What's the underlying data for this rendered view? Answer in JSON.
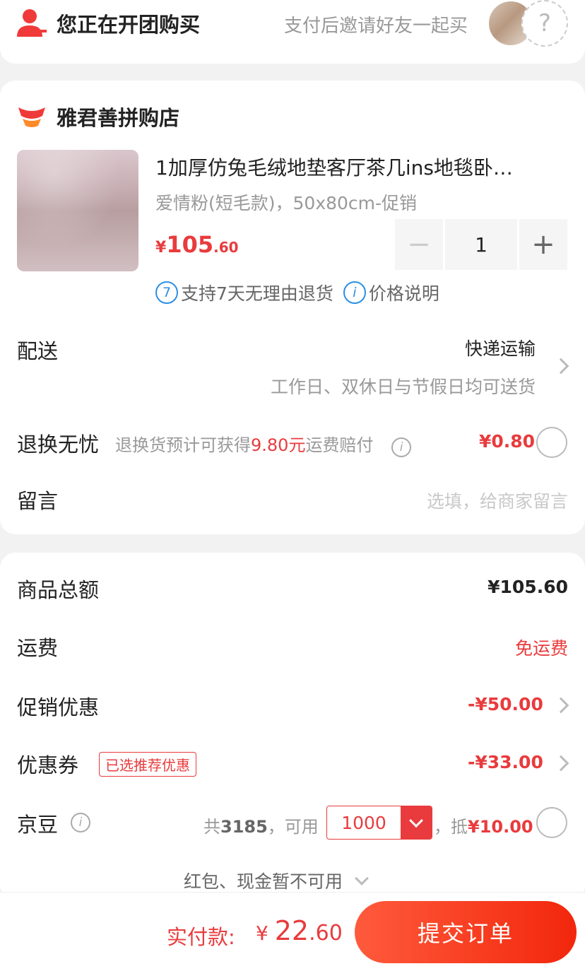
{
  "group": {
    "title": "您正在开团购买",
    "invite": "支付后邀请好友一起买",
    "placeholder_glyph": "?"
  },
  "shop": {
    "name": "雅君善拼购店"
  },
  "product": {
    "title": "1加厚仿兔毛绒地垫客厅茶几ins地毯卧…",
    "spec": "爱情粉(短毛款)，50x80cm-促销",
    "price_symbol": "¥",
    "price_int": "105",
    "price_dec": ".60",
    "quantity": "1",
    "minus": "−",
    "plus": "+",
    "badge_return_icon": "7",
    "badge_return": "支持7天无理由退货",
    "badge_price_icon": "i",
    "badge_price": "价格说明"
  },
  "delivery": {
    "label": "配送",
    "method": "快递运输",
    "note": "工作日、双休日与节假日均可送货"
  },
  "return_service": {
    "label": "退换无忧",
    "desc_prefix": "退换货预计可获得",
    "desc_amount": "9.80元",
    "desc_suffix": "运费赔付",
    "info_icon": "i",
    "price": "¥0.80"
  },
  "message": {
    "label": "留言",
    "placeholder": "选填，给商家留言"
  },
  "summary": {
    "goods_total_label": "商品总额",
    "goods_total": "¥105.60",
    "shipping_label": "运费",
    "shipping": "免运费",
    "promo_label": "促销优惠",
    "promo": "-¥50.00",
    "coupon_label": "优惠券",
    "coupon_tag": "已选推荐优惠",
    "coupon": "-¥33.00",
    "beans_label": "京豆",
    "beans_info_icon": "i",
    "beans_total_prefix": "共",
    "beans_total": "3185",
    "beans_total_suffix": "，可用",
    "beans_use": "1000",
    "beans_deduct_prefix": "，抵",
    "beans_deduct": "¥10.00",
    "redpack": "红包、现金暂不可用"
  },
  "bottom": {
    "pay_label": "实付款:",
    "pay_symbol": "¥ ",
    "pay_int": "22",
    "pay_dec": ".60",
    "submit": "提交订单"
  },
  "colors": {
    "accent": "#e93b3d",
    "submit_start": "#ff5a3c",
    "submit_end": "#f2270c",
    "info_blue": "#2b8fe5"
  }
}
